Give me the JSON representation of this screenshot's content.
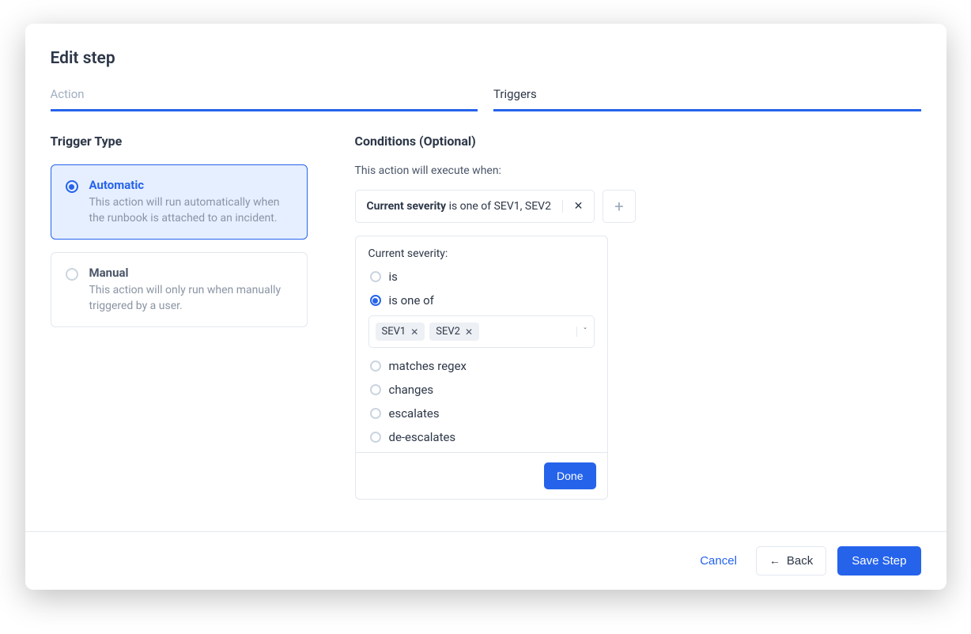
{
  "modal": {
    "title": "Edit step"
  },
  "tabs": {
    "action": {
      "label": "Action"
    },
    "triggers": {
      "label": "Triggers"
    }
  },
  "trigger_type": {
    "heading": "Trigger Type",
    "automatic": {
      "name": "Automatic",
      "desc": "This action will run automatically when the runbook is attached to an incident."
    },
    "manual": {
      "name": "Manual",
      "desc": "This action will only run when manually triggered by a user."
    }
  },
  "conditions": {
    "heading": "Conditions (Optional)",
    "subhead": "This action will execute when:",
    "pill": {
      "field": "Current severity",
      "rest": " is one of SEV1, SEV2"
    },
    "editor": {
      "label": "Current severity:",
      "opts": {
        "is": "is",
        "is_one_of": "is one of",
        "matches_regex": "matches regex",
        "changes": "changes",
        "escalates": "escalates",
        "de_escalates": "de-escalates"
      },
      "tags": {
        "t0": "SEV1",
        "t1": "SEV2"
      },
      "done": "Done"
    }
  },
  "footer": {
    "cancel": "Cancel",
    "back": "Back",
    "save": "Save Step"
  }
}
